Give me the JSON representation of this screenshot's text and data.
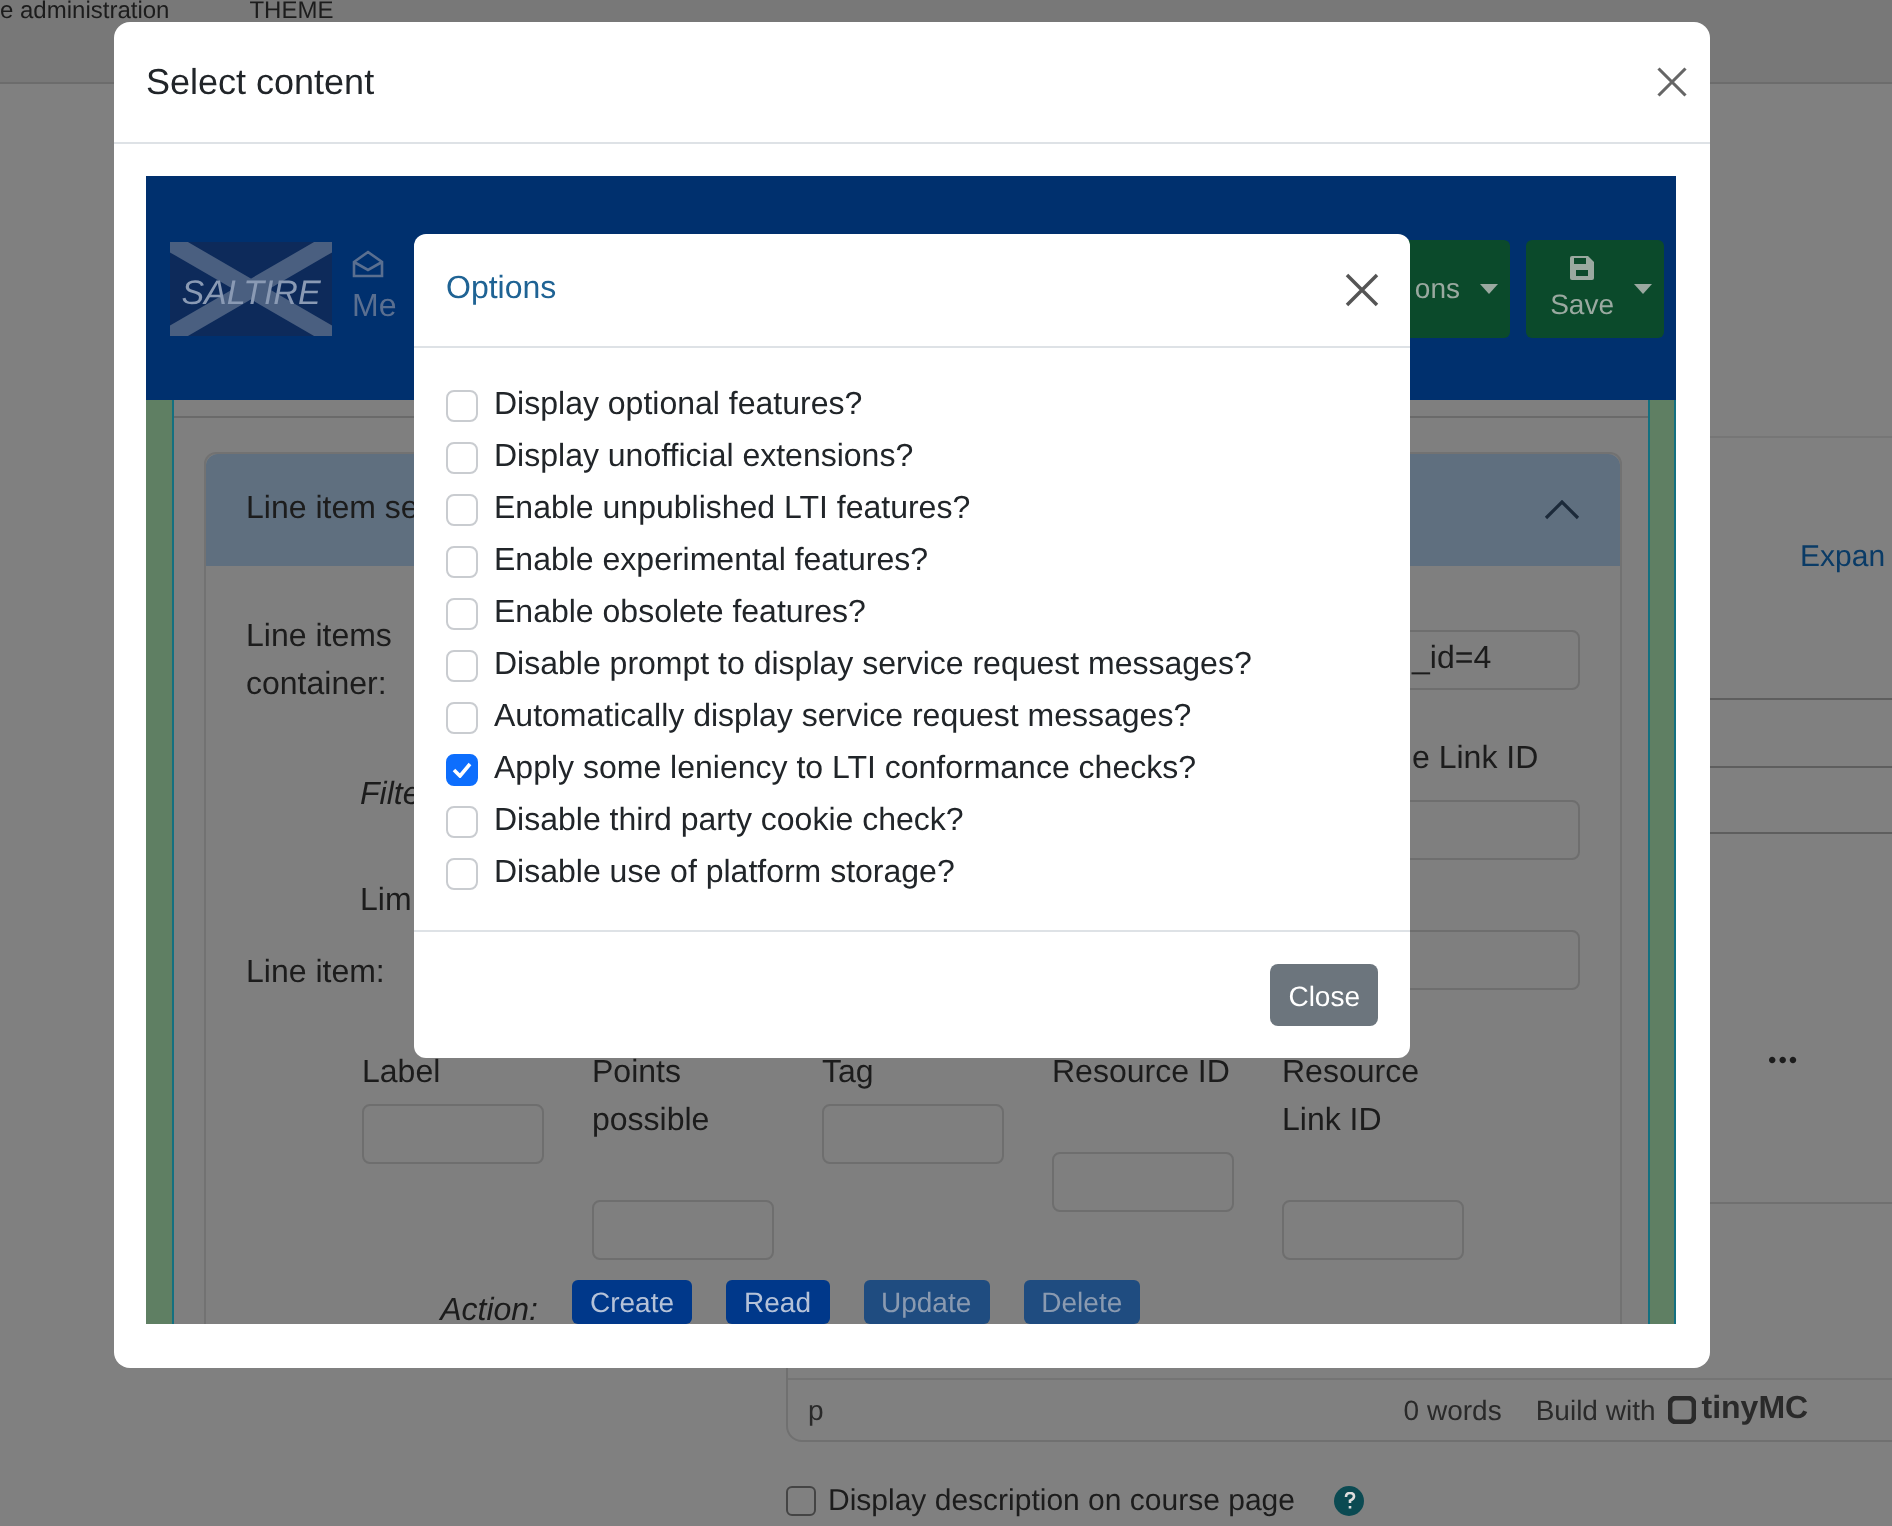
{
  "page": {
    "breadcrumb": [
      "e administration",
      "THEME"
    ],
    "expand_link": "Expan",
    "more_menu": "•••",
    "editor_status": {
      "path": "p",
      "word_count": "0 words",
      "branding": "Build with",
      "logo": "tinyMC"
    },
    "display_description": {
      "label": "Display description on course page",
      "checked": false
    }
  },
  "dialog": {
    "title": "Select content"
  },
  "tool": {
    "logo": "SALTIRE",
    "nav_item": "Me",
    "menu_button": "ons",
    "save_button": "Save",
    "section": {
      "title": "Line item se",
      "expanded": true
    },
    "container_label": "Line items container:",
    "container_value": "_id=4",
    "filter_label": "Filte",
    "resource_link_label": "e Link ID",
    "limit_label": "Lim",
    "line_item_label": "Line item:",
    "line_item_fields": [
      "Label",
      "Points possible",
      "Tag",
      "Resource ID",
      "Resource Link ID"
    ],
    "action_label": "Action:",
    "actions": [
      {
        "label": "Create",
        "disabled": false
      },
      {
        "label": "Read",
        "disabled": false
      },
      {
        "label": "Update",
        "disabled": true
      },
      {
        "label": "Delete",
        "disabled": true
      }
    ]
  },
  "options": {
    "title": "Options",
    "items": [
      {
        "label": "Display optional features?",
        "checked": false
      },
      {
        "label": "Display unofficial extensions?",
        "checked": false
      },
      {
        "label": "Enable unpublished LTI features?",
        "checked": false
      },
      {
        "label": "Enable experimental features?",
        "checked": false
      },
      {
        "label": "Enable obsolete features?",
        "checked": false
      },
      {
        "label": "Disable prompt to display service request messages?",
        "checked": false
      },
      {
        "label": "Automatically display service request messages?",
        "checked": false
      },
      {
        "label": "Apply some leniency to LTI conformance checks?",
        "checked": true
      },
      {
        "label": "Disable third party cookie check?",
        "checked": false
      },
      {
        "label": "Disable use of platform storage?",
        "checked": false
      }
    ],
    "close_button": "Close"
  }
}
